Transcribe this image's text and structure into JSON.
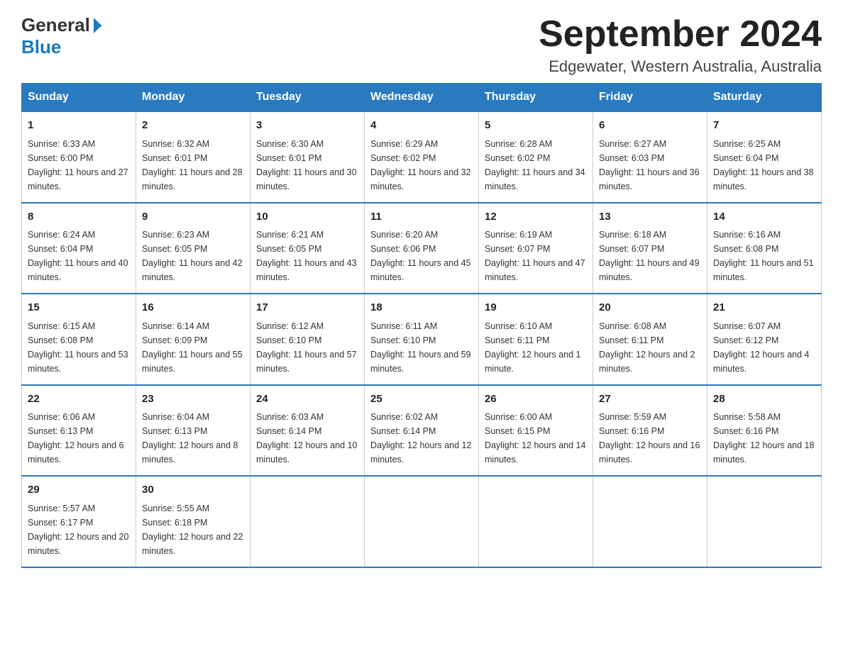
{
  "header": {
    "logo_general": "General",
    "logo_blue": "Blue",
    "title": "September 2024",
    "subtitle": "Edgewater, Western Australia, Australia"
  },
  "days_of_week": [
    "Sunday",
    "Monday",
    "Tuesday",
    "Wednesday",
    "Thursday",
    "Friday",
    "Saturday"
  ],
  "weeks": [
    [
      {
        "day": "1",
        "sunrise": "Sunrise: 6:33 AM",
        "sunset": "Sunset: 6:00 PM",
        "daylight": "Daylight: 11 hours and 27 minutes."
      },
      {
        "day": "2",
        "sunrise": "Sunrise: 6:32 AM",
        "sunset": "Sunset: 6:01 PM",
        "daylight": "Daylight: 11 hours and 28 minutes."
      },
      {
        "day": "3",
        "sunrise": "Sunrise: 6:30 AM",
        "sunset": "Sunset: 6:01 PM",
        "daylight": "Daylight: 11 hours and 30 minutes."
      },
      {
        "day": "4",
        "sunrise": "Sunrise: 6:29 AM",
        "sunset": "Sunset: 6:02 PM",
        "daylight": "Daylight: 11 hours and 32 minutes."
      },
      {
        "day": "5",
        "sunrise": "Sunrise: 6:28 AM",
        "sunset": "Sunset: 6:02 PM",
        "daylight": "Daylight: 11 hours and 34 minutes."
      },
      {
        "day": "6",
        "sunrise": "Sunrise: 6:27 AM",
        "sunset": "Sunset: 6:03 PM",
        "daylight": "Daylight: 11 hours and 36 minutes."
      },
      {
        "day": "7",
        "sunrise": "Sunrise: 6:25 AM",
        "sunset": "Sunset: 6:04 PM",
        "daylight": "Daylight: 11 hours and 38 minutes."
      }
    ],
    [
      {
        "day": "8",
        "sunrise": "Sunrise: 6:24 AM",
        "sunset": "Sunset: 6:04 PM",
        "daylight": "Daylight: 11 hours and 40 minutes."
      },
      {
        "day": "9",
        "sunrise": "Sunrise: 6:23 AM",
        "sunset": "Sunset: 6:05 PM",
        "daylight": "Daylight: 11 hours and 42 minutes."
      },
      {
        "day": "10",
        "sunrise": "Sunrise: 6:21 AM",
        "sunset": "Sunset: 6:05 PM",
        "daylight": "Daylight: 11 hours and 43 minutes."
      },
      {
        "day": "11",
        "sunrise": "Sunrise: 6:20 AM",
        "sunset": "Sunset: 6:06 PM",
        "daylight": "Daylight: 11 hours and 45 minutes."
      },
      {
        "day": "12",
        "sunrise": "Sunrise: 6:19 AM",
        "sunset": "Sunset: 6:07 PM",
        "daylight": "Daylight: 11 hours and 47 minutes."
      },
      {
        "day": "13",
        "sunrise": "Sunrise: 6:18 AM",
        "sunset": "Sunset: 6:07 PM",
        "daylight": "Daylight: 11 hours and 49 minutes."
      },
      {
        "day": "14",
        "sunrise": "Sunrise: 6:16 AM",
        "sunset": "Sunset: 6:08 PM",
        "daylight": "Daylight: 11 hours and 51 minutes."
      }
    ],
    [
      {
        "day": "15",
        "sunrise": "Sunrise: 6:15 AM",
        "sunset": "Sunset: 6:08 PM",
        "daylight": "Daylight: 11 hours and 53 minutes."
      },
      {
        "day": "16",
        "sunrise": "Sunrise: 6:14 AM",
        "sunset": "Sunset: 6:09 PM",
        "daylight": "Daylight: 11 hours and 55 minutes."
      },
      {
        "day": "17",
        "sunrise": "Sunrise: 6:12 AM",
        "sunset": "Sunset: 6:10 PM",
        "daylight": "Daylight: 11 hours and 57 minutes."
      },
      {
        "day": "18",
        "sunrise": "Sunrise: 6:11 AM",
        "sunset": "Sunset: 6:10 PM",
        "daylight": "Daylight: 11 hours and 59 minutes."
      },
      {
        "day": "19",
        "sunrise": "Sunrise: 6:10 AM",
        "sunset": "Sunset: 6:11 PM",
        "daylight": "Daylight: 12 hours and 1 minute."
      },
      {
        "day": "20",
        "sunrise": "Sunrise: 6:08 AM",
        "sunset": "Sunset: 6:11 PM",
        "daylight": "Daylight: 12 hours and 2 minutes."
      },
      {
        "day": "21",
        "sunrise": "Sunrise: 6:07 AM",
        "sunset": "Sunset: 6:12 PM",
        "daylight": "Daylight: 12 hours and 4 minutes."
      }
    ],
    [
      {
        "day": "22",
        "sunrise": "Sunrise: 6:06 AM",
        "sunset": "Sunset: 6:13 PM",
        "daylight": "Daylight: 12 hours and 6 minutes."
      },
      {
        "day": "23",
        "sunrise": "Sunrise: 6:04 AM",
        "sunset": "Sunset: 6:13 PM",
        "daylight": "Daylight: 12 hours and 8 minutes."
      },
      {
        "day": "24",
        "sunrise": "Sunrise: 6:03 AM",
        "sunset": "Sunset: 6:14 PM",
        "daylight": "Daylight: 12 hours and 10 minutes."
      },
      {
        "day": "25",
        "sunrise": "Sunrise: 6:02 AM",
        "sunset": "Sunset: 6:14 PM",
        "daylight": "Daylight: 12 hours and 12 minutes."
      },
      {
        "day": "26",
        "sunrise": "Sunrise: 6:00 AM",
        "sunset": "Sunset: 6:15 PM",
        "daylight": "Daylight: 12 hours and 14 minutes."
      },
      {
        "day": "27",
        "sunrise": "Sunrise: 5:59 AM",
        "sunset": "Sunset: 6:16 PM",
        "daylight": "Daylight: 12 hours and 16 minutes."
      },
      {
        "day": "28",
        "sunrise": "Sunrise: 5:58 AM",
        "sunset": "Sunset: 6:16 PM",
        "daylight": "Daylight: 12 hours and 18 minutes."
      }
    ],
    [
      {
        "day": "29",
        "sunrise": "Sunrise: 5:57 AM",
        "sunset": "Sunset: 6:17 PM",
        "daylight": "Daylight: 12 hours and 20 minutes."
      },
      {
        "day": "30",
        "sunrise": "Sunrise: 5:55 AM",
        "sunset": "Sunset: 6:18 PM",
        "daylight": "Daylight: 12 hours and 22 minutes."
      },
      null,
      null,
      null,
      null,
      null
    ]
  ]
}
